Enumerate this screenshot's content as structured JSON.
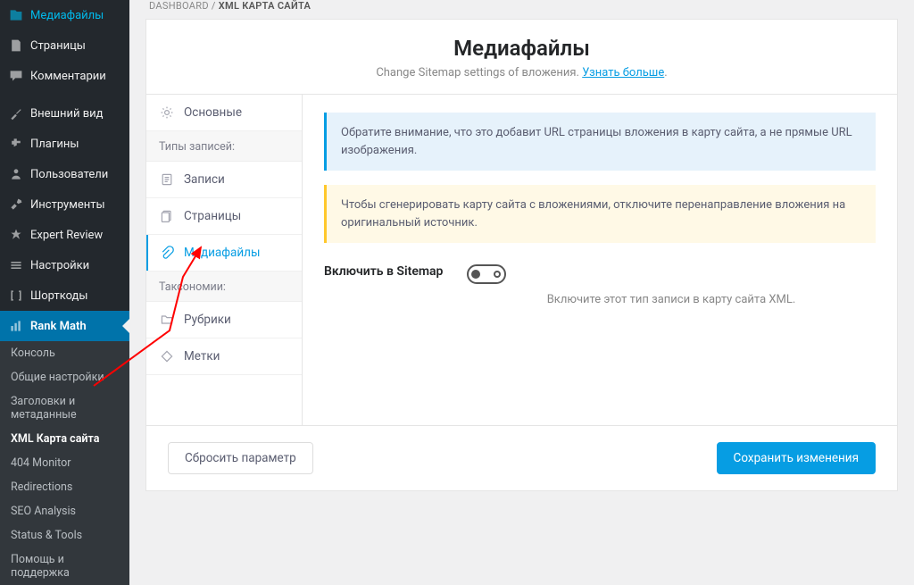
{
  "sidebar": {
    "main_items": [
      {
        "label": "Медиафайлы",
        "icon": "media-icon"
      },
      {
        "label": "Страницы",
        "icon": "page-icon"
      },
      {
        "label": "Комментарии",
        "icon": "comment-icon"
      },
      {
        "label": "Внешний вид",
        "icon": "appearance-icon"
      },
      {
        "label": "Плагины",
        "icon": "plugin-icon"
      },
      {
        "label": "Пользователи",
        "icon": "users-icon"
      },
      {
        "label": "Инструменты",
        "icon": "tools-icon"
      },
      {
        "label": "Expert Review",
        "icon": "review-icon"
      },
      {
        "label": "Настройки",
        "icon": "settings-icon"
      },
      {
        "label": "Шорткоды",
        "icon": "shortcode-icon"
      },
      {
        "label": "Rank Math",
        "icon": "rankmath-icon"
      }
    ],
    "submenu": [
      {
        "label": "Консоль"
      },
      {
        "label": "Общие настройки"
      },
      {
        "label": "Заголовки и метаданные"
      },
      {
        "label": "XML Карта сайта"
      },
      {
        "label": "404 Monitor"
      },
      {
        "label": "Redirections"
      },
      {
        "label": "SEO Analysis"
      },
      {
        "label": "Status & Tools"
      },
      {
        "label": "Помощь и поддержка"
      }
    ]
  },
  "breadcrumb": {
    "root": "DASHBOARD",
    "sep": "/",
    "current": "XML КАРТА САЙТА"
  },
  "header": {
    "title": "Медиафайлы",
    "subtitle_prefix": "Change Sitemap settings of вложения. ",
    "subtitle_link": "Узнать больше",
    "subtitle_suffix": "."
  },
  "tabs": {
    "general": "Основные",
    "section_post_types": "Типы записей:",
    "posts": "Записи",
    "pages": "Страницы",
    "media": "Медиафайлы",
    "section_tax": "Таксономии:",
    "categories": "Рубрики",
    "tags": "Метки"
  },
  "notices": {
    "info": "Обратите внимание, что это добавит URL страницы вложения в карту сайта, а не прямые URL изображения.",
    "warn": "Чтобы сгенерировать карту сайта с вложениями, отключите перенаправление вложения на оригинальный источник."
  },
  "setting": {
    "label": "Включить в Sitemap",
    "help": "Включите этот тип записи в карту сайта XML."
  },
  "footer": {
    "reset": "Сбросить параметр",
    "save": "Сохранить изменения"
  }
}
